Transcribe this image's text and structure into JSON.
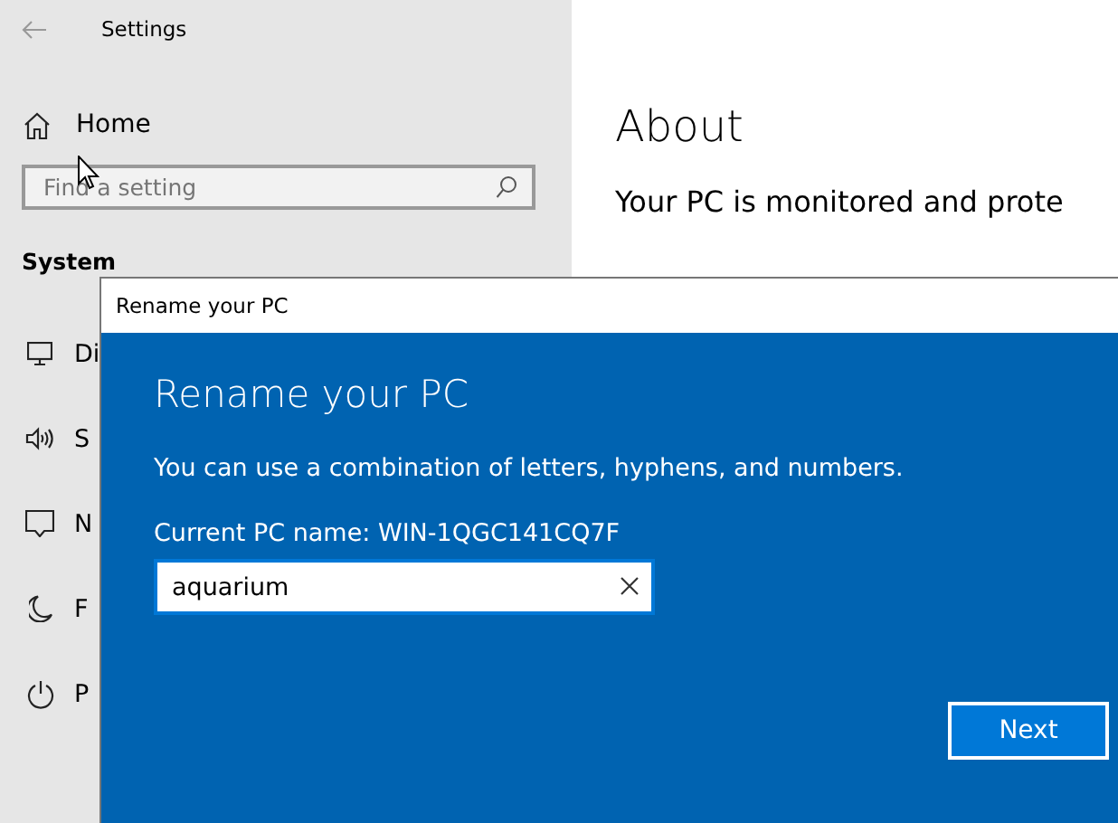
{
  "window": {
    "title": "Settings"
  },
  "sidebar": {
    "home": "Home",
    "search": {
      "placeholder": "Find a setting"
    },
    "section": "System",
    "items": [
      {
        "kind": "display",
        "label": "Di"
      },
      {
        "kind": "sound",
        "label": "S"
      },
      {
        "kind": "notifications",
        "label": "N"
      },
      {
        "kind": "focus",
        "label": "F"
      },
      {
        "kind": "power",
        "label": "P"
      }
    ]
  },
  "content": {
    "heading": "About",
    "text": "Your PC is monitored and prote"
  },
  "dialog": {
    "title": "Rename your PC",
    "heading": "Rename your PC",
    "description": "You can use a combination of letters, hyphens, and numbers.",
    "current_name": "Current PC name: WIN-1QGC141CQ7F",
    "input": {
      "value": "aquarium"
    },
    "button": "Next"
  }
}
